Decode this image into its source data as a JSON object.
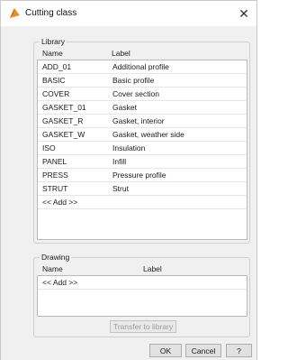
{
  "window": {
    "title": "Cutting class",
    "close_glyph": "✕",
    "icon": "cutting-class-icon"
  },
  "library": {
    "group_label": "Library",
    "columns": {
      "name": "Name",
      "label": "Label"
    },
    "rows": [
      {
        "name": "ADD_01",
        "label": "Additional profile"
      },
      {
        "name": "BASIC",
        "label": "Basic profile"
      },
      {
        "name": "COVER",
        "label": "Cover section"
      },
      {
        "name": "GASKET_01",
        "label": "Gasket"
      },
      {
        "name": "GASKET_R",
        "label": "Gasket, interior"
      },
      {
        "name": "GASKET_W",
        "label": "Gasket, weather side"
      },
      {
        "name": "ISO",
        "label": "Insulation"
      },
      {
        "name": "PANEL",
        "label": "Infill"
      },
      {
        "name": "PRESS",
        "label": "Pressure profile"
      },
      {
        "name": "STRUT",
        "label": "Strut"
      }
    ],
    "add_label": "<< Add >>"
  },
  "drawing": {
    "group_label": "Drawing",
    "columns": {
      "name": "Name",
      "label": "Label"
    },
    "add_label": "<< Add >>",
    "transfer_label": "Transfer to library"
  },
  "footer": {
    "ok_label": "OK",
    "cancel_label": "Cancel",
    "help_label": "?"
  },
  "colors": {
    "icon_fill": "#e8922a",
    "icon_shadow": "#b5651d"
  }
}
